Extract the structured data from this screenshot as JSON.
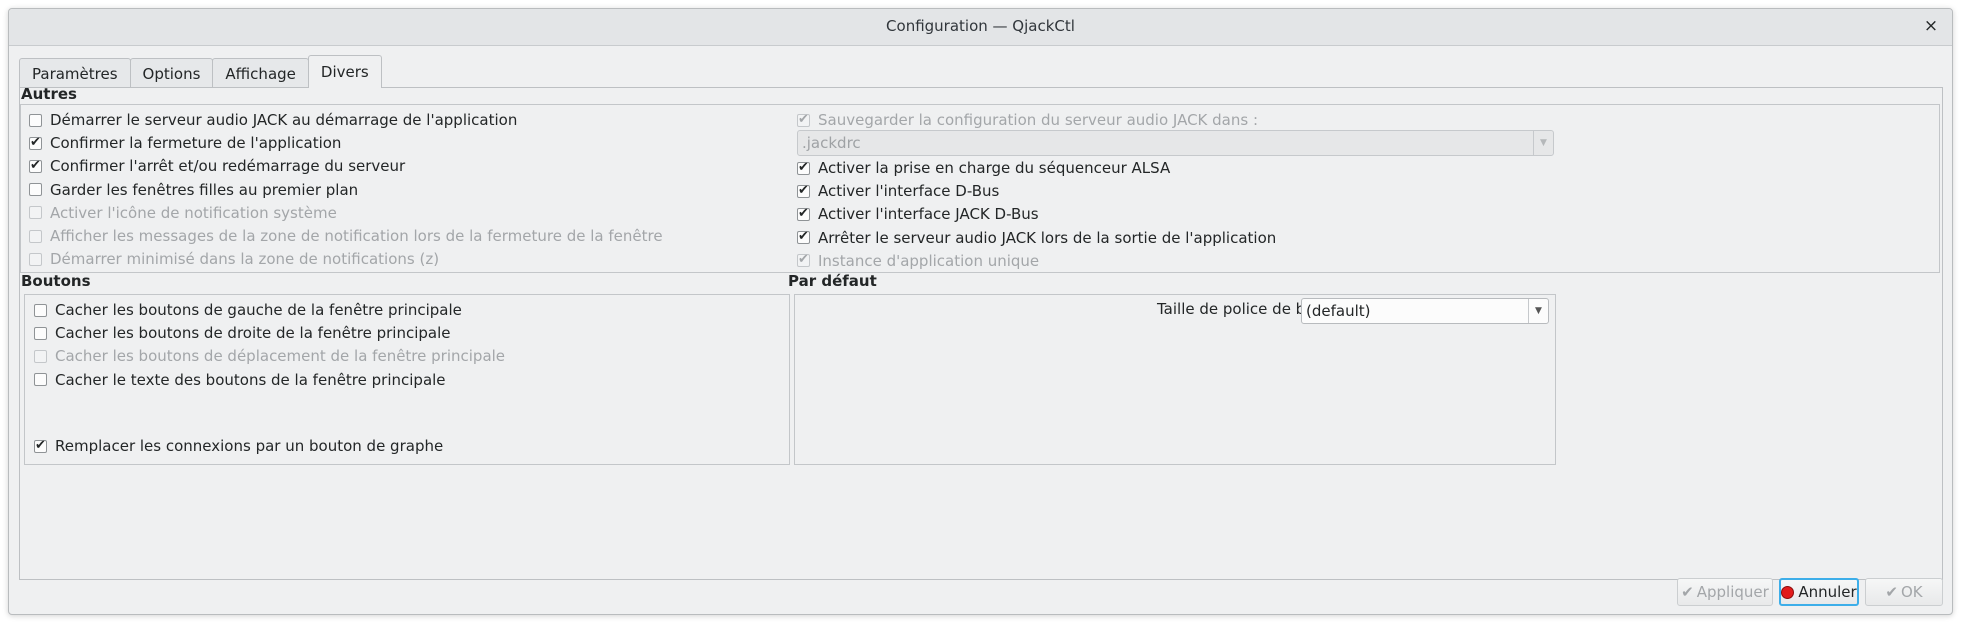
{
  "window": {
    "title": "Configuration — QjackCtl",
    "close_icon": "×"
  },
  "tabs": [
    "Paramètres",
    "Options",
    "Affichage",
    "Divers"
  ],
  "autres": {
    "title": "Autres",
    "left": [
      {
        "label": "Démarrer le serveur audio JACK au démarrage de l'application",
        "checked": false,
        "disabled": false
      },
      {
        "label": "Confirmer la fermeture de l'application",
        "checked": true,
        "disabled": false
      },
      {
        "label": "Confirmer l'arrêt et/ou redémarrage du serveur",
        "checked": true,
        "disabled": false
      },
      {
        "label": "Garder les fenêtres filles au premier plan",
        "checked": false,
        "disabled": false
      },
      {
        "label": "Activer l'icône de notification système",
        "checked": false,
        "disabled": true
      },
      {
        "label": "Afficher les messages de la zone de notification lors de la fermeture de la fenêtre",
        "checked": false,
        "disabled": true
      },
      {
        "label": "Démarrer minimisé dans la zone de notifications (z)",
        "checked": false,
        "disabled": true
      }
    ],
    "save_config": {
      "label": "Sauvegarder la configuration du serveur audio JACK dans :",
      "checked": true,
      "disabled": true
    },
    "config_file": ".jackdrc",
    "right": [
      {
        "label": "Activer la prise en charge du séquenceur ALSA",
        "checked": true,
        "disabled": false
      },
      {
        "label": "Activer l'interface D-Bus",
        "checked": true,
        "disabled": false
      },
      {
        "label": "Activer l'interface JACK D-Bus",
        "checked": true,
        "disabled": false
      },
      {
        "label": "Arrêter le serveur audio JACK lors de la sortie de l'application",
        "checked": true,
        "disabled": false
      },
      {
        "label": "Instance d'application unique",
        "checked": true,
        "disabled": true
      }
    ]
  },
  "boutons": {
    "title": "Boutons",
    "items": [
      {
        "label": "Cacher les boutons de gauche de la fenêtre principale",
        "checked": false,
        "disabled": false
      },
      {
        "label": "Cacher les boutons de droite de la fenêtre principale",
        "checked": false,
        "disabled": false
      },
      {
        "label": "Cacher les boutons de déplacement de la fenêtre principale",
        "checked": false,
        "disabled": true
      },
      {
        "label": "Cacher le texte des boutons de la fenêtre principale",
        "checked": false,
        "disabled": false
      }
    ],
    "graph": {
      "label": "Remplacer les connexions par un bouton de graphe",
      "checked": true,
      "disabled": false
    }
  },
  "defaut": {
    "title": "Par défaut",
    "font_size_label": "Taille de police de base :",
    "font_size_value": "(default)"
  },
  "buttons": {
    "apply": "Appliquer",
    "cancel": "Annuler",
    "ok": "OK"
  },
  "icons": {
    "apply": "check-icon",
    "cancel": "cancel-icon",
    "ok": "ok-icon",
    "combo": "chevron-down-icon"
  },
  "colors": {
    "focus": "#3daee9",
    "cancel_dot": "#e21b1b"
  }
}
